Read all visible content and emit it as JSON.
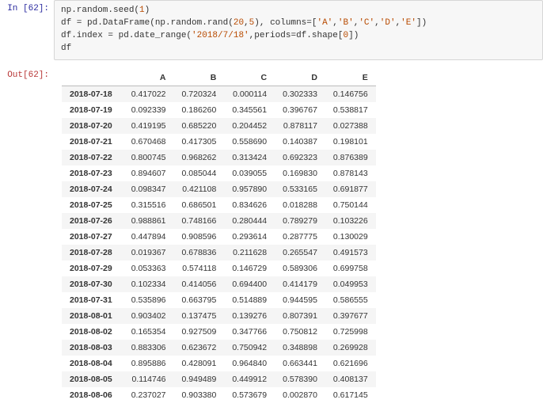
{
  "input": {
    "prompt": "In  [62]:",
    "code": {
      "line1_a": "np.random.seed(",
      "line1_b": "1",
      "line1_c": ")",
      "line2_a": "df = pd.DataFrame(np.random.rand(",
      "line2_b": "20",
      "line2_c": ",",
      "line2_d": "5",
      "line2_e": "), columns=[",
      "line2_f": "'A'",
      "line2_g": ",",
      "line2_h": "'B'",
      "line2_i": ",",
      "line2_j": "'C'",
      "line2_k": ",",
      "line2_l": "'D'",
      "line2_m": ",",
      "line2_n": "'E'",
      "line2_o": "])",
      "line3_a": "df.index = pd.date_range(",
      "line3_b": "'2018/7/18'",
      "line3_c": ",periods=df.shape[",
      "line3_d": "0",
      "line3_e": "])",
      "line4": "df"
    }
  },
  "output": {
    "prompt": "Out[62]:",
    "columns": [
      "A",
      "B",
      "C",
      "D",
      "E"
    ],
    "rows": [
      {
        "idx": "2018-07-18",
        "v": [
          "0.417022",
          "0.720324",
          "0.000114",
          "0.302333",
          "0.146756"
        ]
      },
      {
        "idx": "2018-07-19",
        "v": [
          "0.092339",
          "0.186260",
          "0.345561",
          "0.396767",
          "0.538817"
        ]
      },
      {
        "idx": "2018-07-20",
        "v": [
          "0.419195",
          "0.685220",
          "0.204452",
          "0.878117",
          "0.027388"
        ]
      },
      {
        "idx": "2018-07-21",
        "v": [
          "0.670468",
          "0.417305",
          "0.558690",
          "0.140387",
          "0.198101"
        ]
      },
      {
        "idx": "2018-07-22",
        "v": [
          "0.800745",
          "0.968262",
          "0.313424",
          "0.692323",
          "0.876389"
        ]
      },
      {
        "idx": "2018-07-23",
        "v": [
          "0.894607",
          "0.085044",
          "0.039055",
          "0.169830",
          "0.878143"
        ]
      },
      {
        "idx": "2018-07-24",
        "v": [
          "0.098347",
          "0.421108",
          "0.957890",
          "0.533165",
          "0.691877"
        ]
      },
      {
        "idx": "2018-07-25",
        "v": [
          "0.315516",
          "0.686501",
          "0.834626",
          "0.018288",
          "0.750144"
        ]
      },
      {
        "idx": "2018-07-26",
        "v": [
          "0.988861",
          "0.748166",
          "0.280444",
          "0.789279",
          "0.103226"
        ]
      },
      {
        "idx": "2018-07-27",
        "v": [
          "0.447894",
          "0.908596",
          "0.293614",
          "0.287775",
          "0.130029"
        ]
      },
      {
        "idx": "2018-07-28",
        "v": [
          "0.019367",
          "0.678836",
          "0.211628",
          "0.265547",
          "0.491573"
        ]
      },
      {
        "idx": "2018-07-29",
        "v": [
          "0.053363",
          "0.574118",
          "0.146729",
          "0.589306",
          "0.699758"
        ]
      },
      {
        "idx": "2018-07-30",
        "v": [
          "0.102334",
          "0.414056",
          "0.694400",
          "0.414179",
          "0.049953"
        ]
      },
      {
        "idx": "2018-07-31",
        "v": [
          "0.535896",
          "0.663795",
          "0.514889",
          "0.944595",
          "0.586555"
        ]
      },
      {
        "idx": "2018-08-01",
        "v": [
          "0.903402",
          "0.137475",
          "0.139276",
          "0.807391",
          "0.397677"
        ]
      },
      {
        "idx": "2018-08-02",
        "v": [
          "0.165354",
          "0.927509",
          "0.347766",
          "0.750812",
          "0.725998"
        ]
      },
      {
        "idx": "2018-08-03",
        "v": [
          "0.883306",
          "0.623672",
          "0.750942",
          "0.348898",
          "0.269928"
        ]
      },
      {
        "idx": "2018-08-04",
        "v": [
          "0.895886",
          "0.428091",
          "0.964840",
          "0.663441",
          "0.621696"
        ]
      },
      {
        "idx": "2018-08-05",
        "v": [
          "0.114746",
          "0.949489",
          "0.449912",
          "0.578390",
          "0.408137"
        ]
      },
      {
        "idx": "2018-08-06",
        "v": [
          "0.237027",
          "0.903380",
          "0.573679",
          "0.002870",
          "0.617145"
        ]
      }
    ]
  }
}
